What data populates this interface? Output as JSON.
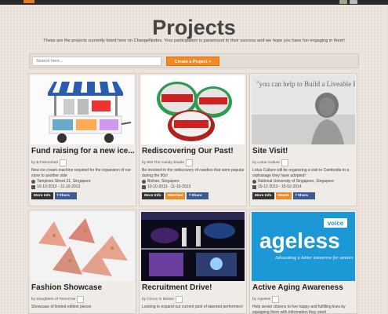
{
  "page": {
    "title": "Projects",
    "intro": "These are the projects currently listed here on ChangeNodes. Your participation is paramount to their success and we hope you have fun engaging in them!"
  },
  "search": {
    "placeholder": "Search here..."
  },
  "create_button": "Create a Project +",
  "projects": [
    {
      "title": "Fund raising for a new ice...",
      "by": "by B Fahrenheit",
      "description": "New ice cream machine required for the expansion of our store to another side",
      "location": "Tampines Street 21, Singapore",
      "dates": "10-10-2013 - 11-10-2013",
      "more": "More Info",
      "watch": "",
      "share": "Share",
      "image": "ice-cream-cart"
    },
    {
      "title": "Rediscovering Our Past!",
      "by": "by 90s The Candy Studio",
      "description": "Be involved in the rediscovery of candies that were popular during the 90s!",
      "location": "Bishan, Singapore",
      "dates": "10-10-2013 - 11-10-2013",
      "more": "More Info",
      "watch": "Watched",
      "share": "Share",
      "image": "candy-tins"
    },
    {
      "title": "Site Visit!",
      "by": "by Lotus Culture",
      "description": "Lotus Culture will be organizing a visit to Cambodia to a orphanage they have adopted!",
      "location": "National University of Singapore, Singapore",
      "dates": "15-12-2013 - 15-02-2014",
      "more": "More Info",
      "watch": "Watch",
      "share": "Share",
      "image": "child-photo",
      "image_caption": "\"you can help to Build a Liveable Future\""
    },
    {
      "title": "Fashion Showcase",
      "by": "by Daughters of Tomorrow",
      "description": "Showcase of limited edition pieces",
      "image": "fabric-pouches"
    },
    {
      "title": "Recruitment Drive!",
      "by": "by Circus In Motion",
      "description": "Looking to expand our current pool of talented performers!",
      "image": "stage-performance"
    },
    {
      "title": "Active Aging Awareness",
      "by": "by Ageless",
      "description": "Help senior citizens to live happy and fulfilling lives by equipping them with information they need",
      "image": "ageless-logo",
      "logo_voice": "voice",
      "logo_word": "ageless",
      "logo_tagline": "Advocating a better tomorrow for seniors"
    }
  ]
}
